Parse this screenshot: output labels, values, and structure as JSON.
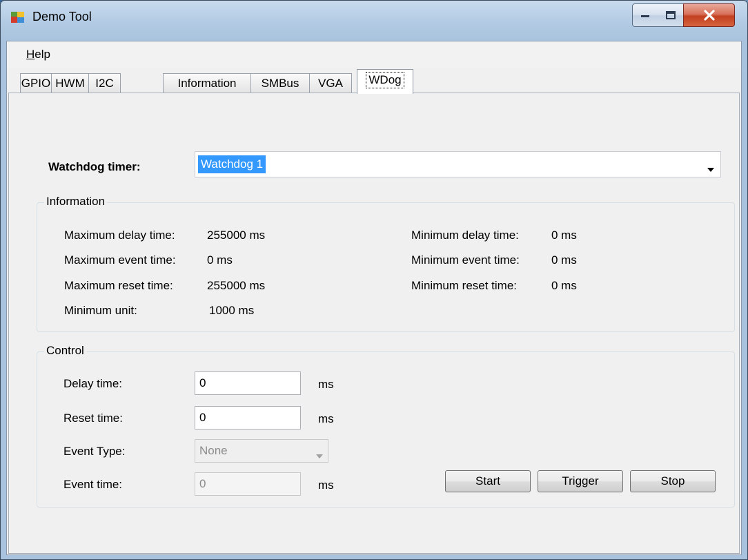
{
  "window": {
    "title": "Demo Tool"
  },
  "menu": {
    "help_prefix": "H",
    "help_rest": "elp"
  },
  "tabs": [
    "GPIO",
    "HWM",
    "I2C",
    "Information",
    "SMBus",
    "VGA",
    "WDog"
  ],
  "watchdog": {
    "label": "Watchdog timer:",
    "selected": "Watchdog 1"
  },
  "information": {
    "title": "Information",
    "max_delay_label": "Maximum delay time:",
    "max_delay_value": "255000 ms",
    "max_event_label": "Maximum event time:",
    "max_event_value": "0 ms",
    "max_reset_label": "Maximum reset time:",
    "max_reset_value": "255000 ms",
    "min_unit_label": "Minimum unit:",
    "min_unit_value": "1000 ms",
    "min_delay_label": "Minimum delay time:",
    "min_delay_value": "0 ms",
    "min_event_label": "Minimum event time:",
    "min_event_value": "0 ms",
    "min_reset_label": "Minimum reset time:",
    "min_reset_value": "0 ms"
  },
  "control": {
    "title": "Control",
    "delay_label": "Delay time:",
    "delay_value": "0",
    "delay_unit": "ms",
    "reset_label": "Reset time:",
    "reset_value": "0",
    "reset_unit": "ms",
    "event_type_label": "Event Type:",
    "event_type_value": "None",
    "event_time_label": "Event time:",
    "event_time_value": "0",
    "event_time_unit": "ms",
    "start_label": "Start",
    "trigger_label": "Trigger",
    "stop_label": "Stop"
  }
}
